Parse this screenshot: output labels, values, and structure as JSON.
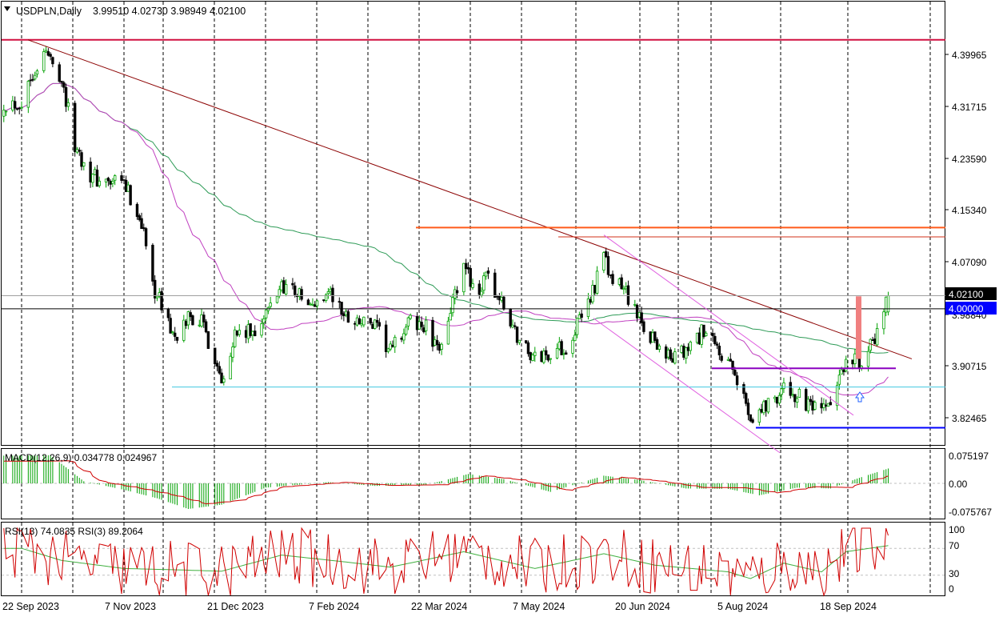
{
  "header": {
    "symbol_label": "USDPLN,Daily",
    "ohlc": "3.99510 4.02730 3.98949 4.02100"
  },
  "colors": {
    "bull_candle": "#00a000",
    "bear_candle": "#000000",
    "trendline": "#8b0000",
    "resistance": "#ff5a1a",
    "support_cyan": "#40c8e0",
    "support_blue": "#0000ff",
    "purple_level": "#8a00c0",
    "channel": "#e060e0",
    "ma_green": "#2e9b57",
    "ma_purple": "#c040c0",
    "macd_hist": "#00a000",
    "macd_signal": "#d00000",
    "rsi13": "#40b040",
    "rsi3": "#d00000"
  },
  "price_panel": {
    "y_ticks": [
      "4.39965",
      "4.31715",
      "4.23590",
      "4.15340",
      "4.07090",
      "3.98840",
      "3.90715",
      "3.82465"
    ],
    "current_price": "4.02100",
    "level_marker": "4.00000",
    "arrow_icon": "up-arrow-icon"
  },
  "macd_panel": {
    "label": "MACD(12,26,9) 0.034778 0.024967",
    "y_ticks": [
      "0.075197",
      "0.00",
      "-0.075767"
    ]
  },
  "rsi_panel": {
    "label": "RSI(13) 74.0835 RSI(3) 89.2064",
    "y_ticks": [
      "100",
      "70",
      "30",
      "0"
    ]
  },
  "x_axis": {
    "labels": [
      "22 Sep 2023",
      "7 Nov 2023",
      "21 Dec 2023",
      "7 Feb 2024",
      "22 Mar 2024",
      "7 May 2024",
      "20 Jun 2024",
      "5 Aug 2024",
      "18 Sep 2024"
    ]
  },
  "chart_data": {
    "type": "candlestick",
    "title": "USDPLN,Daily",
    "y_range": [
      3.77,
      4.43
    ],
    "last_ohlc": {
      "open": 3.9951,
      "high": 4.0273,
      "low": 3.98949,
      "close": 4.021
    },
    "control_points": [
      [
        "2023-09-22",
        4.33
      ],
      [
        "2023-09-27",
        4.38
      ],
      [
        "2023-10-03",
        4.41
      ],
      [
        "2023-10-10",
        4.37
      ],
      [
        "2023-10-16",
        4.26
      ],
      [
        "2023-10-24",
        4.21
      ],
      [
        "2023-10-31",
        4.2
      ],
      [
        "2023-11-07",
        4.2
      ],
      [
        "2023-11-15",
        4.14
      ],
      [
        "2023-11-20",
        4.04
      ],
      [
        "2023-11-27",
        3.98
      ],
      [
        "2023-12-01",
        3.94
      ],
      [
        "2023-12-06",
        3.99
      ],
      [
        "2023-12-12",
        3.98
      ],
      [
        "2023-12-18",
        3.92
      ],
      [
        "2023-12-21",
        3.89
      ],
      [
        "2023-12-27",
        3.96
      ],
      [
        "2024-01-03",
        3.96
      ],
      [
        "2024-01-10",
        3.99
      ],
      [
        "2024-01-17",
        4.04
      ],
      [
        "2024-01-23",
        4.03
      ],
      [
        "2024-01-30",
        4.0
      ],
      [
        "2024-02-07",
        4.03
      ],
      [
        "2024-02-14",
        3.99
      ],
      [
        "2024-02-21",
        3.98
      ],
      [
        "2024-02-28",
        3.97
      ],
      [
        "2024-03-06",
        3.93
      ],
      [
        "2024-03-11",
        3.96
      ],
      [
        "2024-03-15",
        3.98
      ],
      [
        "2024-03-22",
        3.97
      ],
      [
        "2024-03-27",
        3.93
      ],
      [
        "2024-04-02",
        4.0
      ],
      [
        "2024-04-08",
        4.06
      ],
      [
        "2024-04-15",
        4.03
      ],
      [
        "2024-04-19",
        4.05
      ],
      [
        "2024-04-26",
        4.0
      ],
      [
        "2024-05-03",
        3.95
      ],
      [
        "2024-05-10",
        3.92
      ],
      [
        "2024-05-17",
        3.93
      ],
      [
        "2024-05-24",
        3.94
      ],
      [
        "2024-05-30",
        3.98
      ],
      [
        "2024-06-05",
        4.03
      ],
      [
        "2024-06-10",
        4.08
      ],
      [
        "2024-06-14",
        4.04
      ],
      [
        "2024-06-20",
        4.03
      ],
      [
        "2024-06-26",
        3.98
      ],
      [
        "2024-07-03",
        3.95
      ],
      [
        "2024-07-10",
        3.92
      ],
      [
        "2024-07-17",
        3.93
      ],
      [
        "2024-07-24",
        3.96
      ],
      [
        "2024-07-30",
        3.94
      ],
      [
        "2024-08-05",
        3.91
      ],
      [
        "2024-08-12",
        3.86
      ],
      [
        "2024-08-15",
        3.83
      ],
      [
        "2024-08-20",
        3.84
      ],
      [
        "2024-08-26",
        3.86
      ],
      [
        "2024-08-30",
        3.87
      ],
      [
        "2024-09-05",
        3.86
      ],
      [
        "2024-09-11",
        3.84
      ],
      [
        "2024-09-16",
        3.83
      ],
      [
        "2024-09-20",
        3.85
      ],
      [
        "2024-09-25",
        3.89
      ],
      [
        "2024-09-27",
        3.93
      ],
      [
        "2024-10-03",
        3.92
      ],
      [
        "2024-10-09",
        3.94
      ],
      [
        "2024-10-14",
        3.99
      ],
      [
        "2024-10-16",
        4.021
      ]
    ],
    "horizontal_levels": [
      4.43,
      4.13,
      4.115,
      4.0,
      3.905,
      3.875,
      3.81
    ],
    "macd": {
      "label": "MACD(12,26,9)",
      "values": [
        0.034778,
        0.024967
      ],
      "y_range": [
        -0.085,
        0.085
      ],
      "control_points": [
        [
          "2023-09-22",
          0.065
        ],
        [
          "2023-10-05",
          0.066
        ],
        [
          "2023-10-20",
          0.005
        ],
        [
          "2023-11-07",
          -0.015
        ],
        [
          "2023-11-22",
          -0.035
        ],
        [
          "2023-12-06",
          -0.06
        ],
        [
          "2023-12-21",
          -0.05
        ],
        [
          "2024-01-10",
          -0.01
        ],
        [
          "2024-02-07",
          0.003
        ],
        [
          "2024-02-28",
          -0.006
        ],
        [
          "2024-03-22",
          -0.004
        ],
        [
          "2024-04-10",
          0.022
        ],
        [
          "2024-04-26",
          0.01
        ],
        [
          "2024-05-17",
          -0.02
        ],
        [
          "2024-06-10",
          0.018
        ],
        [
          "2024-06-26",
          0.008
        ],
        [
          "2024-07-17",
          -0.012
        ],
        [
          "2024-08-05",
          -0.013
        ],
        [
          "2024-08-19",
          -0.028
        ],
        [
          "2024-09-05",
          -0.01
        ],
        [
          "2024-09-20",
          -0.012
        ],
        [
          "2024-10-03",
          0.013
        ],
        [
          "2024-10-16",
          0.034778
        ]
      ]
    },
    "rsi": {
      "label": "RSI(13) RSI(3)",
      "values": [
        74.0835,
        89.2064
      ],
      "y_range": [
        0,
        100
      ],
      "rsi13_control_points": [
        [
          "2023-09-22",
          70
        ],
        [
          "2023-10-10",
          52
        ],
        [
          "2023-11-07",
          40
        ],
        [
          "2023-12-01",
          38
        ],
        [
          "2023-12-21",
          36
        ],
        [
          "2024-01-17",
          60
        ],
        [
          "2024-02-14",
          50
        ],
        [
          "2024-03-06",
          42
        ],
        [
          "2024-04-08",
          65
        ],
        [
          "2024-05-10",
          40
        ],
        [
          "2024-06-10",
          62
        ],
        [
          "2024-07-03",
          45
        ],
        [
          "2024-08-05",
          35
        ],
        [
          "2024-08-15",
          25
        ],
        [
          "2024-08-30",
          48
        ],
        [
          "2024-09-16",
          35
        ],
        [
          "2024-09-27",
          65
        ],
        [
          "2024-10-16",
          74.0835
        ]
      ]
    }
  }
}
